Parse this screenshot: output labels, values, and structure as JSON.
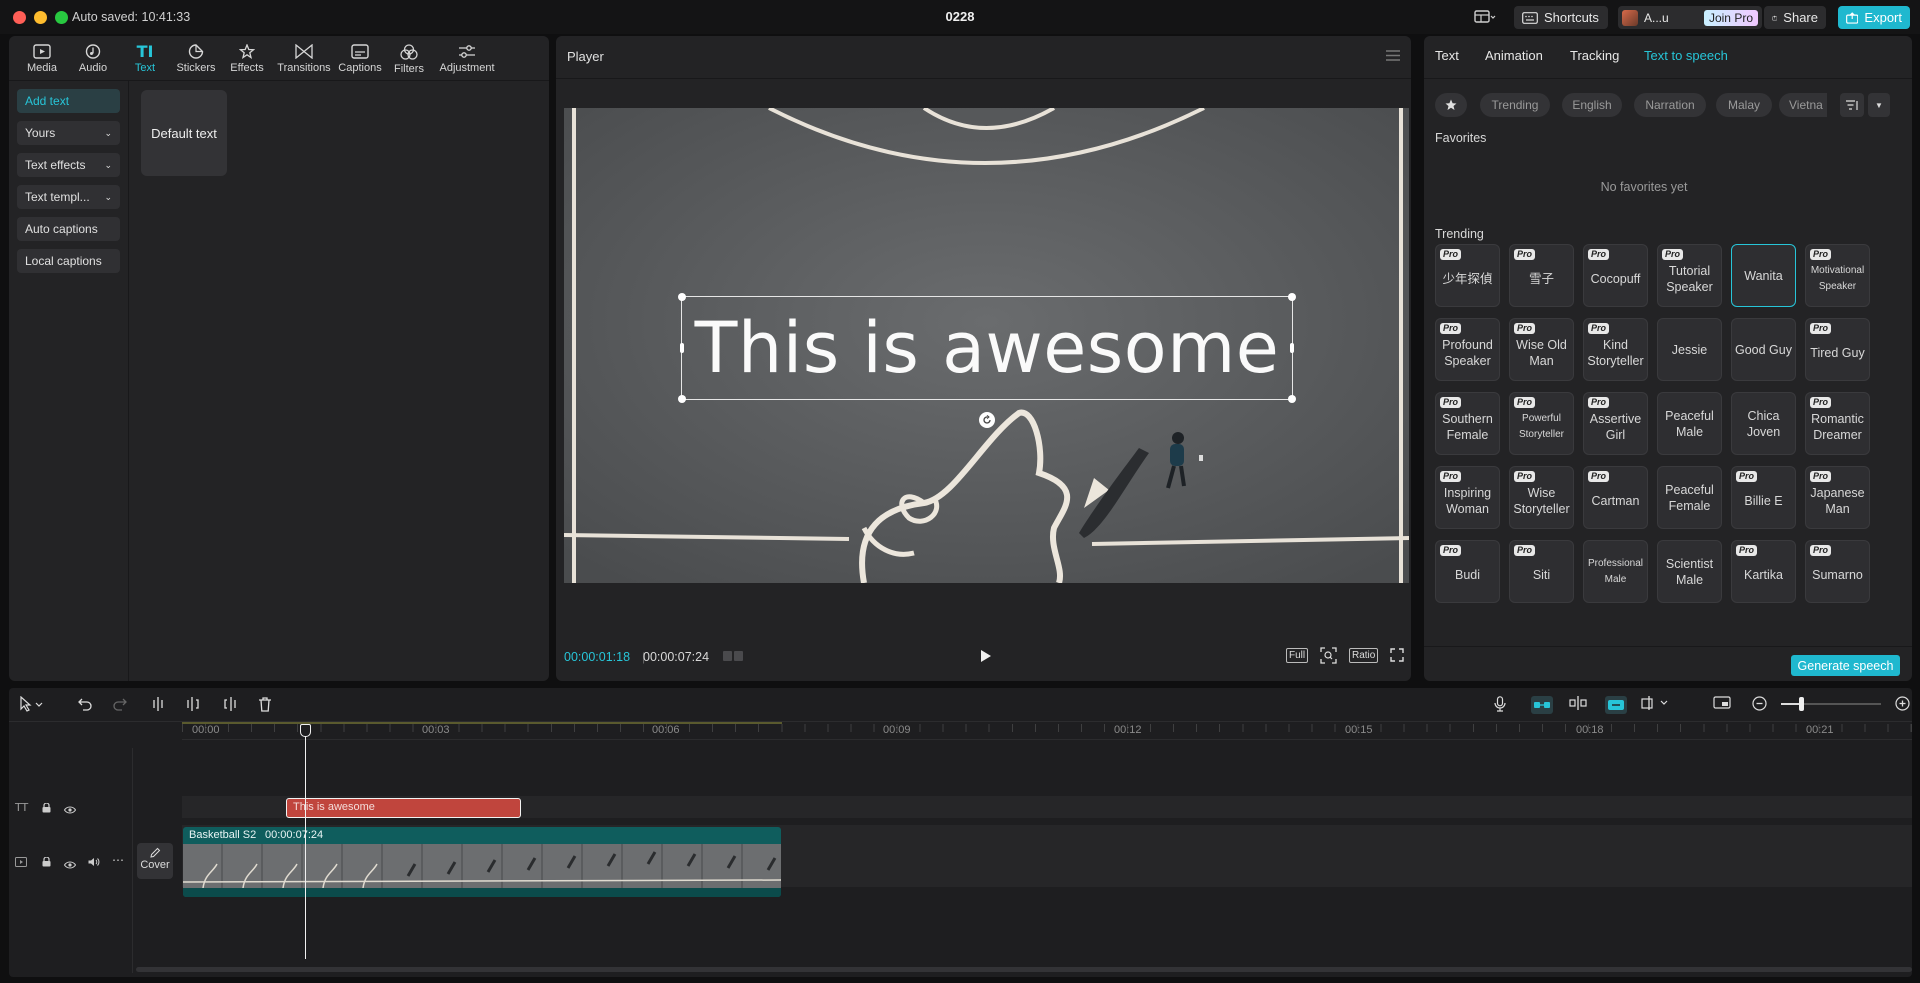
{
  "app": {
    "autosave": "Auto saved: 10:41:33",
    "project_name": "0228",
    "shortcuts_label": "Shortcuts",
    "user_label": "A...u",
    "join_pro_label": "Join Pro",
    "share_label": "Share",
    "export_label": "Export"
  },
  "toolbar": {
    "items": [
      {
        "label": "Media",
        "icon": "media-icon"
      },
      {
        "label": "Audio",
        "icon": "audio-icon"
      },
      {
        "label": "Text",
        "icon": "text-icon"
      },
      {
        "label": "Stickers",
        "icon": "stickers-icon"
      },
      {
        "label": "Effects",
        "icon": "effects-icon"
      },
      {
        "label": "Transitions",
        "icon": "transitions-icon"
      },
      {
        "label": "Captions",
        "icon": "captions-icon"
      },
      {
        "label": "Filters",
        "icon": "filters-icon"
      },
      {
        "label": "Adjustment",
        "icon": "adjustment-icon"
      }
    ],
    "active": "Text"
  },
  "text_sidebar": {
    "items": [
      "Add text",
      "Yours",
      "Text effects",
      "Text templ...",
      "Auto captions",
      "Local captions"
    ],
    "default_text_card": "Default text"
  },
  "player": {
    "title": "Player",
    "overlay_text": "This is awesome",
    "current_time": "00:00:01:18",
    "total_time": "00:00:07:24",
    "full_label": "Full",
    "ratio_label": "Ratio"
  },
  "right_panel": {
    "tabs": [
      "Text",
      "Animation",
      "Tracking",
      "Text to speech"
    ],
    "active_tab": "Text to speech",
    "chips": [
      "Trending",
      "English",
      "Narration",
      "Malay",
      "Vietna"
    ],
    "favorites_title": "Favorites",
    "no_favorites": "No favorites yet",
    "trending_title": "Trending",
    "voices": [
      {
        "name": "少年探偵",
        "pro": true
      },
      {
        "name": "雪子",
        "pro": true
      },
      {
        "name": "Cocopuff",
        "pro": true
      },
      {
        "name": "Tutorial Speaker",
        "pro": true
      },
      {
        "name": "Wanita",
        "pro": false,
        "selected": true
      },
      {
        "name": "Motivational Speaker",
        "pro": true
      },
      {
        "name": "Profound Speaker",
        "pro": true
      },
      {
        "name": "Wise Old Man",
        "pro": true
      },
      {
        "name": "Kind Storyteller",
        "pro": true
      },
      {
        "name": "Jessie",
        "pro": false
      },
      {
        "name": "Good Guy",
        "pro": false
      },
      {
        "name": "Tired Guy",
        "pro": true
      },
      {
        "name": "Southern Female",
        "pro": true
      },
      {
        "name": "Powerful Storyteller",
        "pro": true
      },
      {
        "name": "Assertive Girl",
        "pro": true
      },
      {
        "name": "Peaceful Male",
        "pro": false
      },
      {
        "name": "Chica Joven",
        "pro": false
      },
      {
        "name": "Romantic Dreamer",
        "pro": true
      },
      {
        "name": "Inspiring Woman",
        "pro": true
      },
      {
        "name": "Wise Storyteller",
        "pro": true
      },
      {
        "name": "Cartman",
        "pro": true
      },
      {
        "name": "Peaceful Female",
        "pro": false
      },
      {
        "name": "Billie E",
        "pro": true
      },
      {
        "name": "Japanese Man",
        "pro": true
      },
      {
        "name": "Budi",
        "pro": true
      },
      {
        "name": "Siti",
        "pro": true
      },
      {
        "name": "Professional Male",
        "pro": false
      },
      {
        "name": "Scientist Male",
        "pro": false
      },
      {
        "name": "Kartika",
        "pro": true
      },
      {
        "name": "Sumarno",
        "pro": true
      }
    ],
    "pro_badge": "Pro",
    "generate_label": "Generate speech"
  },
  "timeline": {
    "ruler": [
      "00:00",
      "00:03",
      "00:06",
      "00:09",
      "00:12",
      "00:15",
      "00:18",
      "00:21"
    ],
    "text_clip": "This is awesome",
    "video_clip_name": "Basketball S2",
    "video_clip_duration": "00:00:07:24",
    "cover_label": "Cover"
  },
  "colors": {
    "accent": "#27c5d8",
    "text_clip": "#c0453d",
    "video_clip": "#0f5d5d",
    "panel": "#232325"
  }
}
